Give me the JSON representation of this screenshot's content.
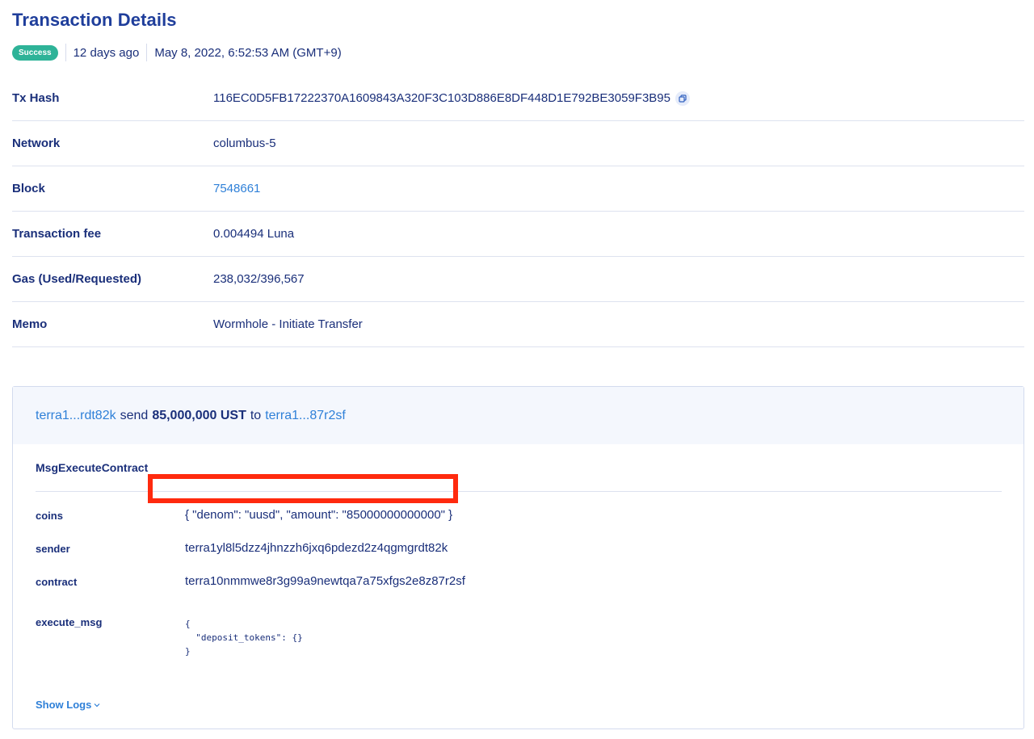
{
  "page": {
    "title": "Transaction Details",
    "status": "Success",
    "relative_time": "12 days ago",
    "timestamp": "May 8, 2022, 6:52:53 AM (GMT+9)"
  },
  "details": [
    {
      "label": "Tx Hash",
      "value": "116EC0D5FB17222370A1609843A320F3C103D886E8DF448D1E792BE3059F3B95"
    },
    {
      "label": "Network",
      "value": "columbus-5"
    },
    {
      "label": "Block",
      "value": "7548661"
    },
    {
      "label": "Transaction fee",
      "value": "0.004494 Luna"
    },
    {
      "label": "Gas (Used/Requested)",
      "value": "238,032/396,567"
    },
    {
      "label": "Memo",
      "value": "Wormhole - Initiate Transfer"
    }
  ],
  "message": {
    "summary": {
      "from": "terra1...rdt82k",
      "verb": "send",
      "amount": "85,000,000 UST",
      "preposition": "to",
      "to": "terra1...87r2sf"
    },
    "type": "MsgExecuteContract",
    "fields": {
      "coins_label": "coins",
      "coins_value": "{ \"denom\": \"uusd\", \"amount\": \"85000000000000\" }",
      "sender_label": "sender",
      "sender_value": "terra1yl8l5dzz4jhnzzh6jxq6pdezd2z4qgmgrdt82k",
      "contract_label": "contract",
      "contract_value": "terra10nmmwe8r3g99a9newtqa7a75xfgs2e8z87r2sf",
      "execute_label": "execute_msg",
      "execute_value": "{\n  \"deposit_tokens\": {}\n}"
    },
    "show_logs": "Show Logs"
  },
  "icons": {
    "copy": "copy-icon",
    "chevron": "chevron-down-icon"
  },
  "colors": {
    "accent": "#2f80d8",
    "text": "#1a2f7a",
    "success": "#2eb398",
    "highlight": "#ff2a0e"
  }
}
